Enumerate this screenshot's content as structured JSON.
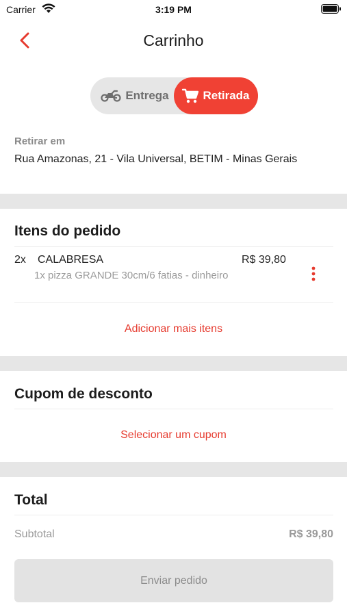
{
  "status_bar": {
    "carrier": "Carrier",
    "time": "3:19 PM"
  },
  "nav": {
    "title": "Carrinho"
  },
  "delivery_toggle": {
    "options": [
      {
        "label": "Entrega",
        "icon": "motorcycle-icon",
        "selected": false
      },
      {
        "label": "Retirada",
        "icon": "cart-icon",
        "selected": true
      }
    ]
  },
  "pickup": {
    "label": "Retirar em",
    "address": "Rua Amazonas, 21 - Vila Universal, BETIM  - Minas Gerais"
  },
  "order_items": {
    "title": "Itens do pedido",
    "items": [
      {
        "qty": "2x",
        "name": "CALABRESA",
        "price": "R$ 39,80",
        "description": "1x pizza GRANDE 30cm/6 fatias - dinheiro"
      }
    ],
    "add_more_label": "Adicionar mais itens"
  },
  "coupon": {
    "title": "Cupom de desconto",
    "select_label": "Selecionar um cupom"
  },
  "total": {
    "title": "Total",
    "subtotal_label": "Subtotal",
    "subtotal_value": "R$ 39,80"
  },
  "submit": {
    "label": "Enviar pedido"
  },
  "colors": {
    "accent": "#f04134",
    "section_gap": "#e6e6e6",
    "muted_text": "#9a9a9a"
  }
}
